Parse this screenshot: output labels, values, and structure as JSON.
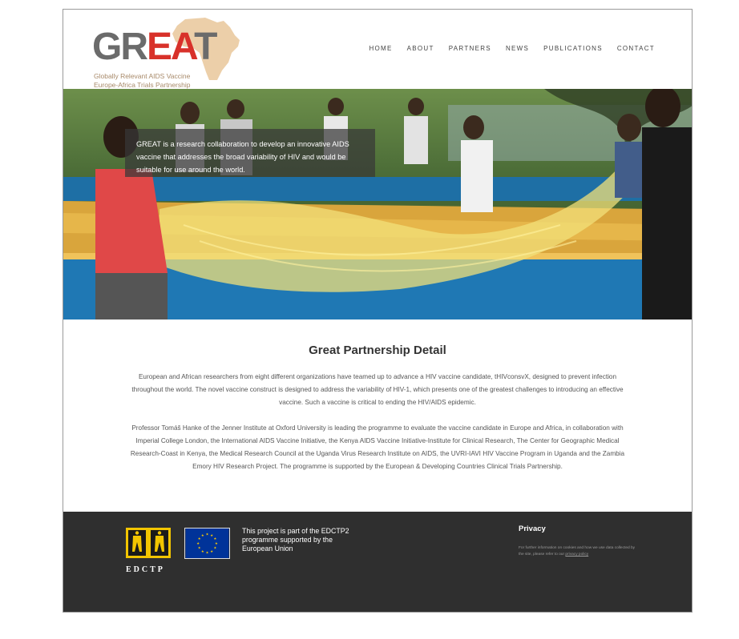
{
  "header": {
    "logo": {
      "part1": "GR",
      "part2": "EA",
      "part3": "T"
    },
    "tagline_line1": "Globally Relevant AIDS Vaccine",
    "tagline_line2": "Europe-Africa Trials Partnership",
    "nav": [
      "HOME",
      "ABOUT",
      "PARTNERS",
      "NEWS",
      "PUBLICATIONS",
      "CONTACT"
    ]
  },
  "hero": {
    "caption": "GREAT is a research collaboration to develop an innovative AIDS vaccine that addresses the broad variability of HIV and would be suitable for use around the world."
  },
  "main": {
    "title": "Great Partnership Detail",
    "paragraph1": "European and African researchers from eight different organizations have teamed up to advance a HIV vaccine candidate, tHIVconsvX, designed to prevent infection throughout the world. The novel vaccine construct is designed to address the variability of HIV-1, which presents one of the greatest challenges to introducing an effective vaccine. Such a vaccine is critical to ending the HIV/AIDS epidemic.",
    "paragraph2": "Professor Tomáš Hanke of the Jenner Institute at Oxford University is leading the programme to evaluate the vaccine candidate in Europe and Africa, in collaboration with Imperial College London, the International AIDS Vaccine Initiative, the Kenya AIDS Vaccine Initiative-Institute for Clinical Research, The Center for Geographic Medical Research-Coast in Kenya, the Medical Research Council at the Uganda Virus Research Institute on AIDS, the UVRI-IAVI HIV Vaccine Program in Uganda and the Zambia Emory HIV Research Project. The programme is supported by the European & Developing Countries Clinical Trials Partnership."
  },
  "footer": {
    "edctp_label": "EDCTP",
    "edctp_note": "This project is part of the EDCTP2 programme supported by the European Union",
    "privacy_title": "Privacy",
    "privacy_text": "For further information on cookies and how we use data collected by the site, please refer to our",
    "privacy_link": "privacy policy"
  },
  "colors": {
    "logo_red": "#d8312a",
    "logo_grey": "#6b6b6b",
    "footer_bg": "#2f2f2f",
    "eu_blue": "#003399",
    "eu_star": "#ffcc00",
    "edctp_yellow": "#f2c500"
  }
}
